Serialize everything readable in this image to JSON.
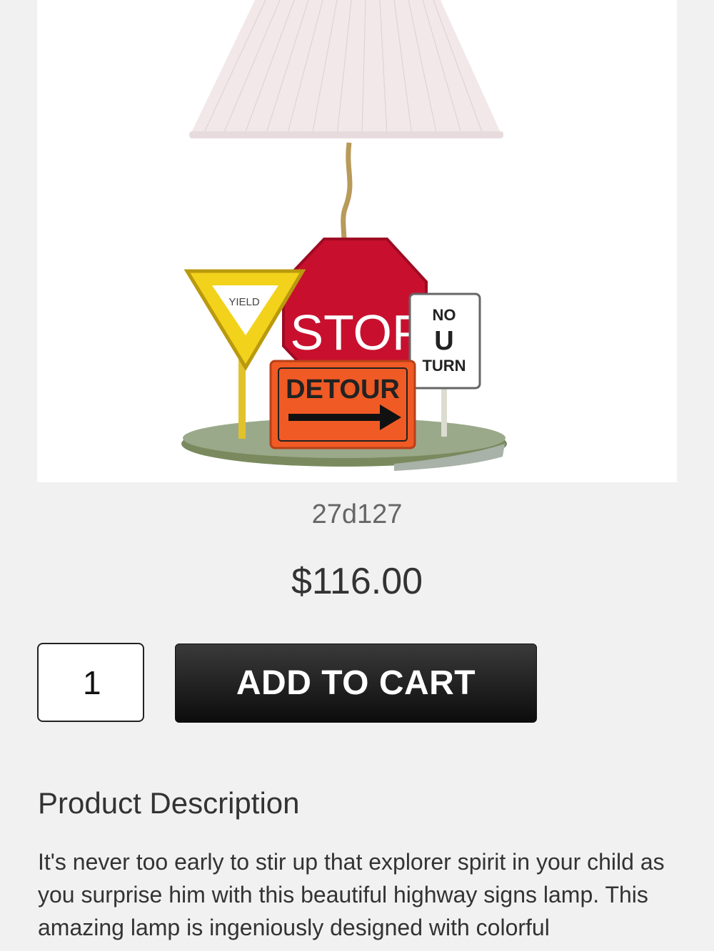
{
  "product": {
    "image": {
      "alt_signs": {
        "yield": "YIELD",
        "stop": "STOP",
        "no_u_turn": [
          "NO",
          "U",
          "TURN"
        ],
        "detour": "DETOUR"
      }
    },
    "sku": "27d127",
    "price": "$116.00",
    "quantity": "1",
    "add_to_cart_label": "ADD TO CART"
  },
  "description": {
    "heading": "Product Description",
    "text": "It's never too early to stir up that explorer spirit in your child as you surprise him with this beautiful highway signs lamp. This amazing lamp is ingeniously designed with colorful"
  },
  "colors": {
    "button": "#1a1a1a",
    "stop_sign": "#c8102e",
    "yield_sign": "#f2d21b",
    "detour_sign": "#f05a24"
  }
}
